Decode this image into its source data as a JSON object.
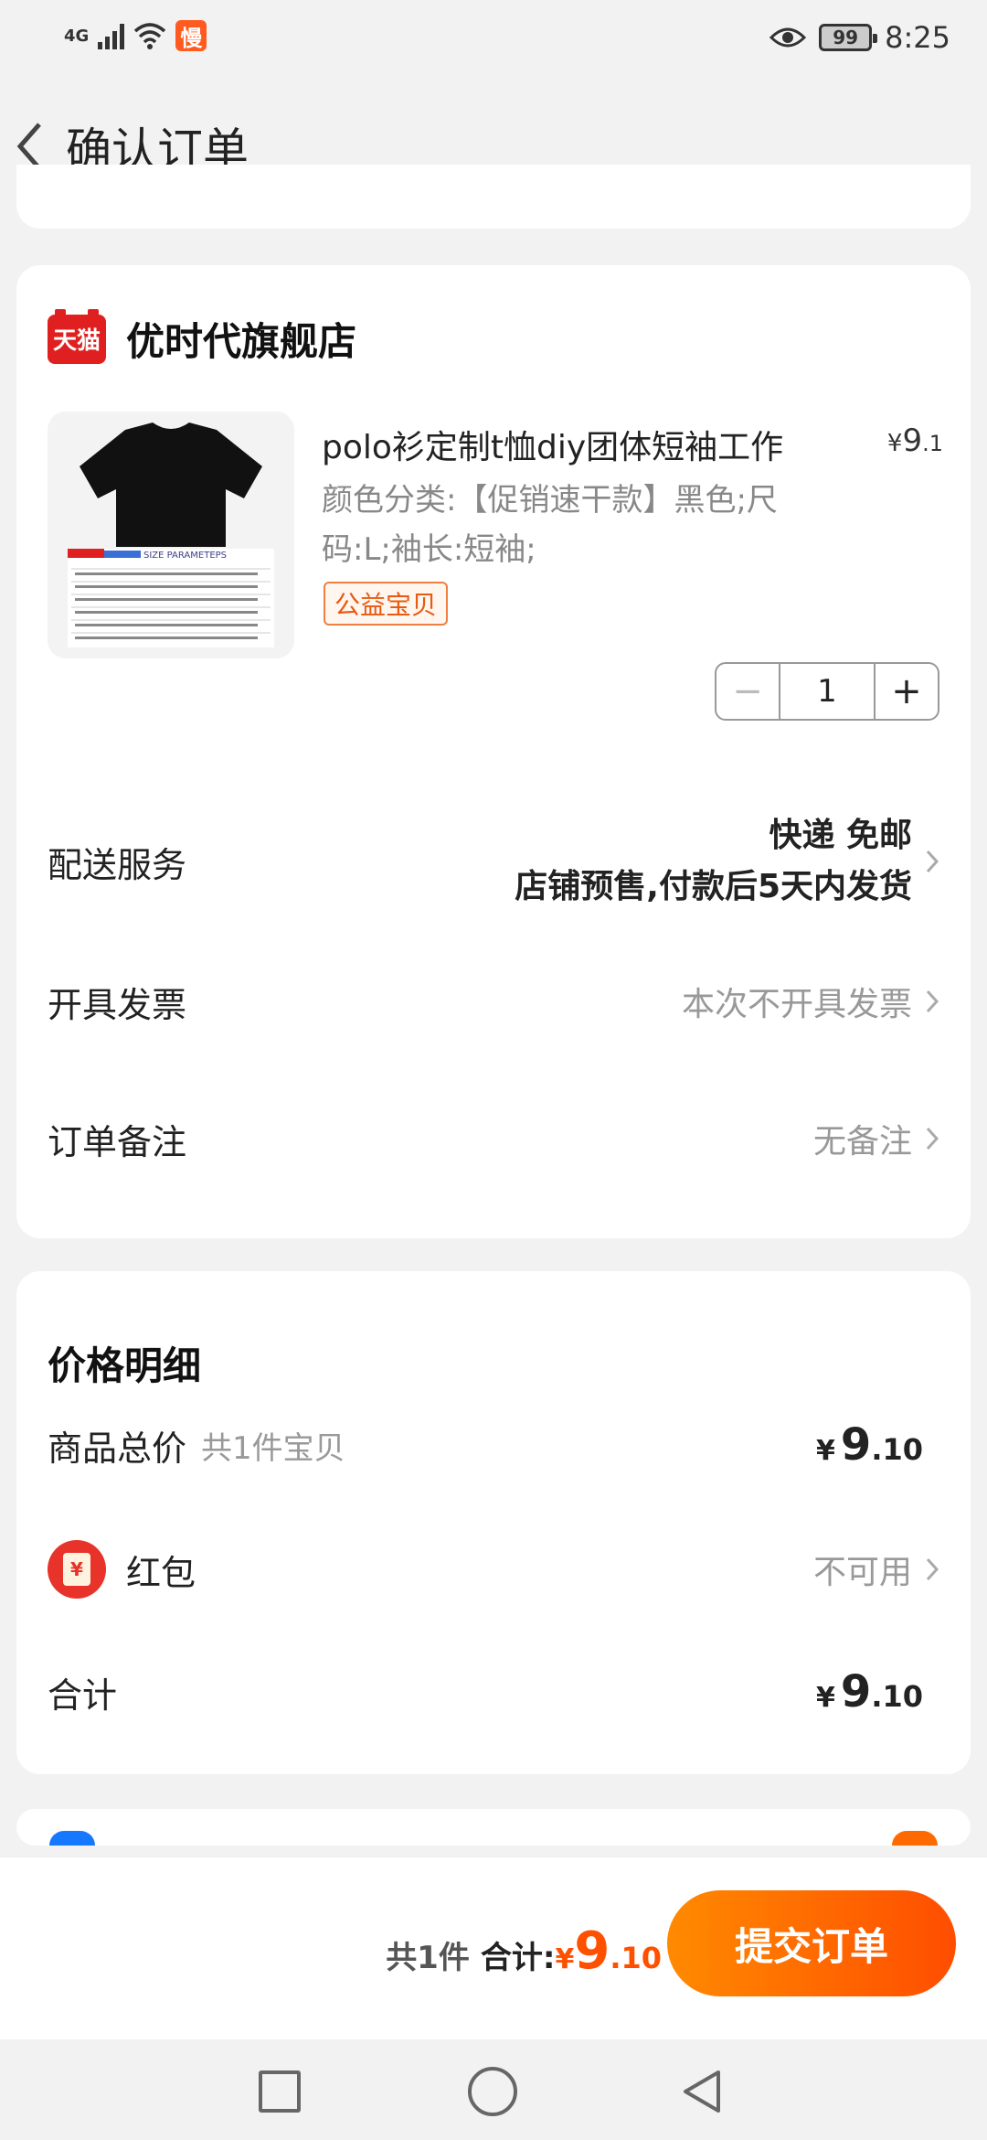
{
  "status_bar": {
    "network": "4G",
    "app_badge": "慢",
    "battery": "99",
    "time": "8:25",
    "icons": [
      "signal-icon",
      "wifi-icon",
      "eye-icon",
      "battery-icon"
    ]
  },
  "header": {
    "title": "确认订单",
    "back_icon": "chevron-left-icon"
  },
  "store": {
    "logo_text": "天猫",
    "name": "优时代旗舰店",
    "product": {
      "title": "polo衫定制t恤diy团体短袖工作",
      "price_symbol": "¥",
      "price_int": "9",
      "price_dec": ".1",
      "sku": "颜色分类:【促销速干款】黑色;尺码:L;袖长:短袖;",
      "tag": "公益宝贝",
      "image_label": "SIZE PARAMETEPS",
      "quantity": "1"
    },
    "delivery": {
      "label": "配送服务",
      "value_line1": "快递 免邮",
      "value_line2": "店铺预售,付款后5天内发货"
    },
    "invoice": {
      "label": "开具发票",
      "value": "本次不开具发票"
    },
    "note": {
      "label": "订单备注",
      "value": "无备注"
    }
  },
  "price_detail": {
    "title": "价格明细",
    "goods_total": {
      "label": "商品总价",
      "sub": "共1件宝贝",
      "yen": "¥",
      "int": "9",
      "dec": ".10"
    },
    "hongbao": {
      "icon_text": "¥",
      "label": "红包",
      "value": "不可用"
    },
    "sum": {
      "label": "合计",
      "yen": "¥",
      "int": "9",
      "dec": ".10"
    }
  },
  "bottom_bar": {
    "count": "共1件",
    "total_label": "合计:",
    "yen": "¥",
    "int": "9",
    "dec": ".10",
    "submit": "提交订单"
  },
  "colors": {
    "accent": "#ff5000",
    "tmall_red": "#e02020",
    "tag_orange": "#e85a10"
  }
}
